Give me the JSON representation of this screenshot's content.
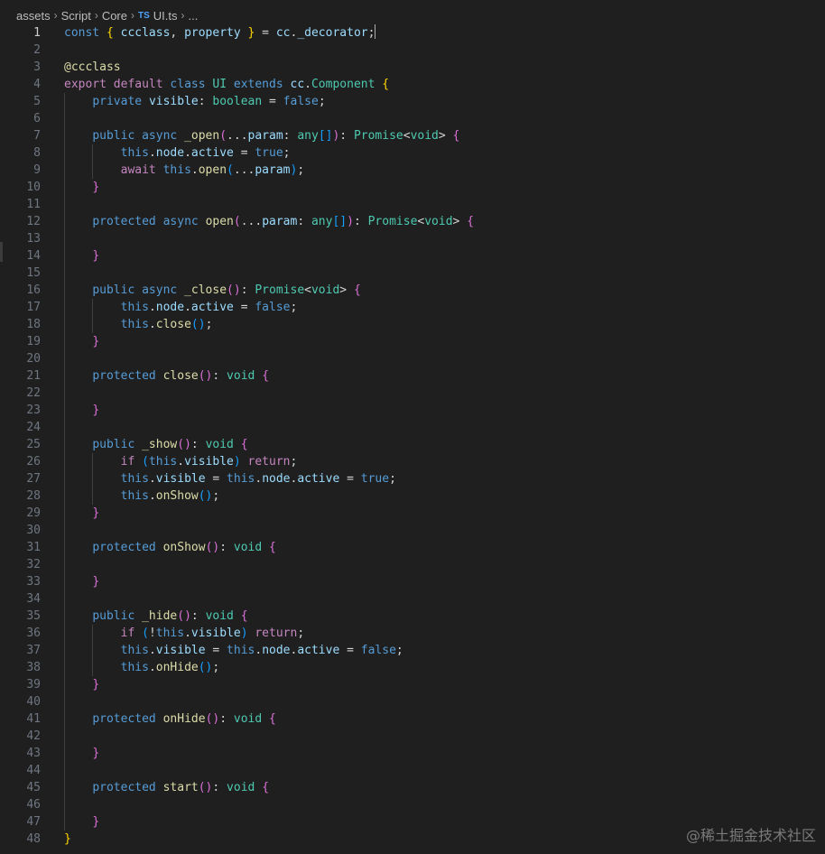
{
  "breadcrumb": {
    "items": [
      "assets",
      "Script",
      "Core",
      "UI.ts",
      "..."
    ],
    "file_icon": "TS"
  },
  "editor": {
    "cursor_line": 1,
    "lines": [
      {
        "n": "1",
        "tokens": [
          [
            "kw",
            "const"
          ],
          [
            "p",
            " "
          ],
          [
            "b1",
            "{"
          ],
          [
            "p",
            " "
          ],
          [
            "var",
            "ccclass"
          ],
          [
            "p",
            ", "
          ],
          [
            "var",
            "property"
          ],
          [
            "p",
            " "
          ],
          [
            "b1",
            "}"
          ],
          [
            "p",
            " = "
          ],
          [
            "var",
            "cc"
          ],
          [
            "p",
            "."
          ],
          [
            "var",
            "_decorator"
          ],
          [
            "p",
            ";"
          ]
        ]
      },
      {
        "n": "2",
        "tokens": []
      },
      {
        "n": "3",
        "tokens": [
          [
            "dec",
            "@ccclass"
          ]
        ]
      },
      {
        "n": "4",
        "tokens": [
          [
            "ctl",
            "export"
          ],
          [
            "p",
            " "
          ],
          [
            "ctl",
            "default"
          ],
          [
            "p",
            " "
          ],
          [
            "kw",
            "class"
          ],
          [
            "p",
            " "
          ],
          [
            "type",
            "UI"
          ],
          [
            "p",
            " "
          ],
          [
            "kw",
            "extends"
          ],
          [
            "p",
            " "
          ],
          [
            "var",
            "cc"
          ],
          [
            "p",
            "."
          ],
          [
            "type",
            "Component"
          ],
          [
            "p",
            " "
          ],
          [
            "b1",
            "{"
          ]
        ]
      },
      {
        "n": "5",
        "tokens": [
          [
            "p",
            "    "
          ],
          [
            "kw",
            "private"
          ],
          [
            "p",
            " "
          ],
          [
            "var",
            "visible"
          ],
          [
            "p",
            ": "
          ],
          [
            "type",
            "boolean"
          ],
          [
            "p",
            " = "
          ],
          [
            "kw",
            "false"
          ],
          [
            "p",
            ";"
          ]
        ]
      },
      {
        "n": "6",
        "tokens": []
      },
      {
        "n": "7",
        "tokens": [
          [
            "p",
            "    "
          ],
          [
            "kw",
            "public"
          ],
          [
            "p",
            " "
          ],
          [
            "kw",
            "async"
          ],
          [
            "p",
            " "
          ],
          [
            "fn",
            "_open"
          ],
          [
            "b2",
            "("
          ],
          [
            "p",
            "..."
          ],
          [
            "var",
            "param"
          ],
          [
            "p",
            ": "
          ],
          [
            "type",
            "any"
          ],
          [
            "b3",
            "[]"
          ],
          [
            "b2",
            ")"
          ],
          [
            "p",
            ": "
          ],
          [
            "type",
            "Promise"
          ],
          [
            "p",
            "<"
          ],
          [
            "type",
            "void"
          ],
          [
            "p",
            "> "
          ],
          [
            "b2",
            "{"
          ]
        ]
      },
      {
        "n": "8",
        "tokens": [
          [
            "p",
            "        "
          ],
          [
            "kw",
            "this"
          ],
          [
            "p",
            "."
          ],
          [
            "var",
            "node"
          ],
          [
            "p",
            "."
          ],
          [
            "var",
            "active"
          ],
          [
            "p",
            " = "
          ],
          [
            "kw",
            "true"
          ],
          [
            "p",
            ";"
          ]
        ]
      },
      {
        "n": "9",
        "tokens": [
          [
            "p",
            "        "
          ],
          [
            "ctl",
            "await"
          ],
          [
            "p",
            " "
          ],
          [
            "kw",
            "this"
          ],
          [
            "p",
            "."
          ],
          [
            "fn",
            "open"
          ],
          [
            "b3",
            "("
          ],
          [
            "p",
            "..."
          ],
          [
            "var",
            "param"
          ],
          [
            "b3",
            ")"
          ],
          [
            "p",
            ";"
          ]
        ]
      },
      {
        "n": "10",
        "tokens": [
          [
            "p",
            "    "
          ],
          [
            "b2",
            "}"
          ]
        ]
      },
      {
        "n": "11",
        "tokens": []
      },
      {
        "n": "12",
        "tokens": [
          [
            "p",
            "    "
          ],
          [
            "kw",
            "protected"
          ],
          [
            "p",
            " "
          ],
          [
            "kw",
            "async"
          ],
          [
            "p",
            " "
          ],
          [
            "fn",
            "open"
          ],
          [
            "b2",
            "("
          ],
          [
            "p",
            "..."
          ],
          [
            "var",
            "param"
          ],
          [
            "p",
            ": "
          ],
          [
            "type",
            "any"
          ],
          [
            "b3",
            "[]"
          ],
          [
            "b2",
            ")"
          ],
          [
            "p",
            ": "
          ],
          [
            "type",
            "Promise"
          ],
          [
            "p",
            "<"
          ],
          [
            "type",
            "void"
          ],
          [
            "p",
            "> "
          ],
          [
            "b2",
            "{"
          ]
        ]
      },
      {
        "n": "13",
        "tokens": []
      },
      {
        "n": "14",
        "tokens": [
          [
            "p",
            "    "
          ],
          [
            "b2",
            "}"
          ]
        ]
      },
      {
        "n": "15",
        "tokens": []
      },
      {
        "n": "16",
        "tokens": [
          [
            "p",
            "    "
          ],
          [
            "kw",
            "public"
          ],
          [
            "p",
            " "
          ],
          [
            "kw",
            "async"
          ],
          [
            "p",
            " "
          ],
          [
            "fn",
            "_close"
          ],
          [
            "b2",
            "()"
          ],
          [
            "p",
            ": "
          ],
          [
            "type",
            "Promise"
          ],
          [
            "p",
            "<"
          ],
          [
            "type",
            "void"
          ],
          [
            "p",
            "> "
          ],
          [
            "b2",
            "{"
          ]
        ]
      },
      {
        "n": "17",
        "tokens": [
          [
            "p",
            "        "
          ],
          [
            "kw",
            "this"
          ],
          [
            "p",
            "."
          ],
          [
            "var",
            "node"
          ],
          [
            "p",
            "."
          ],
          [
            "var",
            "active"
          ],
          [
            "p",
            " = "
          ],
          [
            "kw",
            "false"
          ],
          [
            "p",
            ";"
          ]
        ]
      },
      {
        "n": "18",
        "tokens": [
          [
            "p",
            "        "
          ],
          [
            "kw",
            "this"
          ],
          [
            "p",
            "."
          ],
          [
            "fn",
            "close"
          ],
          [
            "b3",
            "()"
          ],
          [
            "p",
            ";"
          ]
        ]
      },
      {
        "n": "19",
        "tokens": [
          [
            "p",
            "    "
          ],
          [
            "b2",
            "}"
          ]
        ]
      },
      {
        "n": "20",
        "tokens": []
      },
      {
        "n": "21",
        "tokens": [
          [
            "p",
            "    "
          ],
          [
            "kw",
            "protected"
          ],
          [
            "p",
            " "
          ],
          [
            "fn",
            "close"
          ],
          [
            "b2",
            "()"
          ],
          [
            "p",
            ": "
          ],
          [
            "type",
            "void"
          ],
          [
            "p",
            " "
          ],
          [
            "b2",
            "{"
          ]
        ]
      },
      {
        "n": "22",
        "tokens": []
      },
      {
        "n": "23",
        "tokens": [
          [
            "p",
            "    "
          ],
          [
            "b2",
            "}"
          ]
        ]
      },
      {
        "n": "24",
        "tokens": []
      },
      {
        "n": "25",
        "tokens": [
          [
            "p",
            "    "
          ],
          [
            "kw",
            "public"
          ],
          [
            "p",
            " "
          ],
          [
            "fn",
            "_show"
          ],
          [
            "b2",
            "()"
          ],
          [
            "p",
            ": "
          ],
          [
            "type",
            "void"
          ],
          [
            "p",
            " "
          ],
          [
            "b2",
            "{"
          ]
        ]
      },
      {
        "n": "26",
        "tokens": [
          [
            "p",
            "        "
          ],
          [
            "ctl",
            "if"
          ],
          [
            "p",
            " "
          ],
          [
            "b3",
            "("
          ],
          [
            "kw",
            "this"
          ],
          [
            "p",
            "."
          ],
          [
            "var",
            "visible"
          ],
          [
            "b3",
            ")"
          ],
          [
            "p",
            " "
          ],
          [
            "ctl",
            "return"
          ],
          [
            "p",
            ";"
          ]
        ]
      },
      {
        "n": "27",
        "tokens": [
          [
            "p",
            "        "
          ],
          [
            "kw",
            "this"
          ],
          [
            "p",
            "."
          ],
          [
            "var",
            "visible"
          ],
          [
            "p",
            " = "
          ],
          [
            "kw",
            "this"
          ],
          [
            "p",
            "."
          ],
          [
            "var",
            "node"
          ],
          [
            "p",
            "."
          ],
          [
            "var",
            "active"
          ],
          [
            "p",
            " = "
          ],
          [
            "kw",
            "true"
          ],
          [
            "p",
            ";"
          ]
        ]
      },
      {
        "n": "28",
        "tokens": [
          [
            "p",
            "        "
          ],
          [
            "kw",
            "this"
          ],
          [
            "p",
            "."
          ],
          [
            "fn",
            "onShow"
          ],
          [
            "b3",
            "()"
          ],
          [
            "p",
            ";"
          ]
        ]
      },
      {
        "n": "29",
        "tokens": [
          [
            "p",
            "    "
          ],
          [
            "b2",
            "}"
          ]
        ]
      },
      {
        "n": "30",
        "tokens": []
      },
      {
        "n": "31",
        "tokens": [
          [
            "p",
            "    "
          ],
          [
            "kw",
            "protected"
          ],
          [
            "p",
            " "
          ],
          [
            "fn",
            "onShow"
          ],
          [
            "b2",
            "()"
          ],
          [
            "p",
            ": "
          ],
          [
            "type",
            "void"
          ],
          [
            "p",
            " "
          ],
          [
            "b2",
            "{"
          ]
        ]
      },
      {
        "n": "32",
        "tokens": []
      },
      {
        "n": "33",
        "tokens": [
          [
            "p",
            "    "
          ],
          [
            "b2",
            "}"
          ]
        ]
      },
      {
        "n": "34",
        "tokens": []
      },
      {
        "n": "35",
        "tokens": [
          [
            "p",
            "    "
          ],
          [
            "kw",
            "public"
          ],
          [
            "p",
            " "
          ],
          [
            "fn",
            "_hide"
          ],
          [
            "b2",
            "()"
          ],
          [
            "p",
            ": "
          ],
          [
            "type",
            "void"
          ],
          [
            "p",
            " "
          ],
          [
            "b2",
            "{"
          ]
        ]
      },
      {
        "n": "36",
        "tokens": [
          [
            "p",
            "        "
          ],
          [
            "ctl",
            "if"
          ],
          [
            "p",
            " "
          ],
          [
            "b3",
            "("
          ],
          [
            "p",
            "!"
          ],
          [
            "kw",
            "this"
          ],
          [
            "p",
            "."
          ],
          [
            "var",
            "visible"
          ],
          [
            "b3",
            ")"
          ],
          [
            "p",
            " "
          ],
          [
            "ctl",
            "return"
          ],
          [
            "p",
            ";"
          ]
        ]
      },
      {
        "n": "37",
        "tokens": [
          [
            "p",
            "        "
          ],
          [
            "kw",
            "this"
          ],
          [
            "p",
            "."
          ],
          [
            "var",
            "visible"
          ],
          [
            "p",
            " = "
          ],
          [
            "kw",
            "this"
          ],
          [
            "p",
            "."
          ],
          [
            "var",
            "node"
          ],
          [
            "p",
            "."
          ],
          [
            "var",
            "active"
          ],
          [
            "p",
            " = "
          ],
          [
            "kw",
            "false"
          ],
          [
            "p",
            ";"
          ]
        ]
      },
      {
        "n": "38",
        "tokens": [
          [
            "p",
            "        "
          ],
          [
            "kw",
            "this"
          ],
          [
            "p",
            "."
          ],
          [
            "fn",
            "onHide"
          ],
          [
            "b3",
            "()"
          ],
          [
            "p",
            ";"
          ]
        ]
      },
      {
        "n": "39",
        "tokens": [
          [
            "p",
            "    "
          ],
          [
            "b2",
            "}"
          ]
        ]
      },
      {
        "n": "40",
        "tokens": []
      },
      {
        "n": "41",
        "tokens": [
          [
            "p",
            "    "
          ],
          [
            "kw",
            "protected"
          ],
          [
            "p",
            " "
          ],
          [
            "fn",
            "onHide"
          ],
          [
            "b2",
            "()"
          ],
          [
            "p",
            ": "
          ],
          [
            "type",
            "void"
          ],
          [
            "p",
            " "
          ],
          [
            "b2",
            "{"
          ]
        ]
      },
      {
        "n": "42",
        "tokens": []
      },
      {
        "n": "43",
        "tokens": [
          [
            "p",
            "    "
          ],
          [
            "b2",
            "}"
          ]
        ]
      },
      {
        "n": "44",
        "tokens": []
      },
      {
        "n": "45",
        "tokens": [
          [
            "p",
            "    "
          ],
          [
            "kw",
            "protected"
          ],
          [
            "p",
            " "
          ],
          [
            "fn",
            "start"
          ],
          [
            "b2",
            "()"
          ],
          [
            "p",
            ": "
          ],
          [
            "type",
            "void"
          ],
          [
            "p",
            " "
          ],
          [
            "b2",
            "{"
          ]
        ]
      },
      {
        "n": "46",
        "tokens": []
      },
      {
        "n": "47",
        "tokens": [
          [
            "p",
            "    "
          ],
          [
            "b2",
            "}"
          ]
        ]
      },
      {
        "n": "48",
        "tokens": [
          [
            "b1",
            "}"
          ]
        ]
      }
    ]
  },
  "watermark": "@稀土掘金技术社区",
  "colors": {
    "background": "#1f1f1f",
    "keyword": "#569cd6",
    "control": "#c586c0",
    "function": "#dcdcaa",
    "variable": "#9cdcfe",
    "type": "#4ec9b0"
  }
}
